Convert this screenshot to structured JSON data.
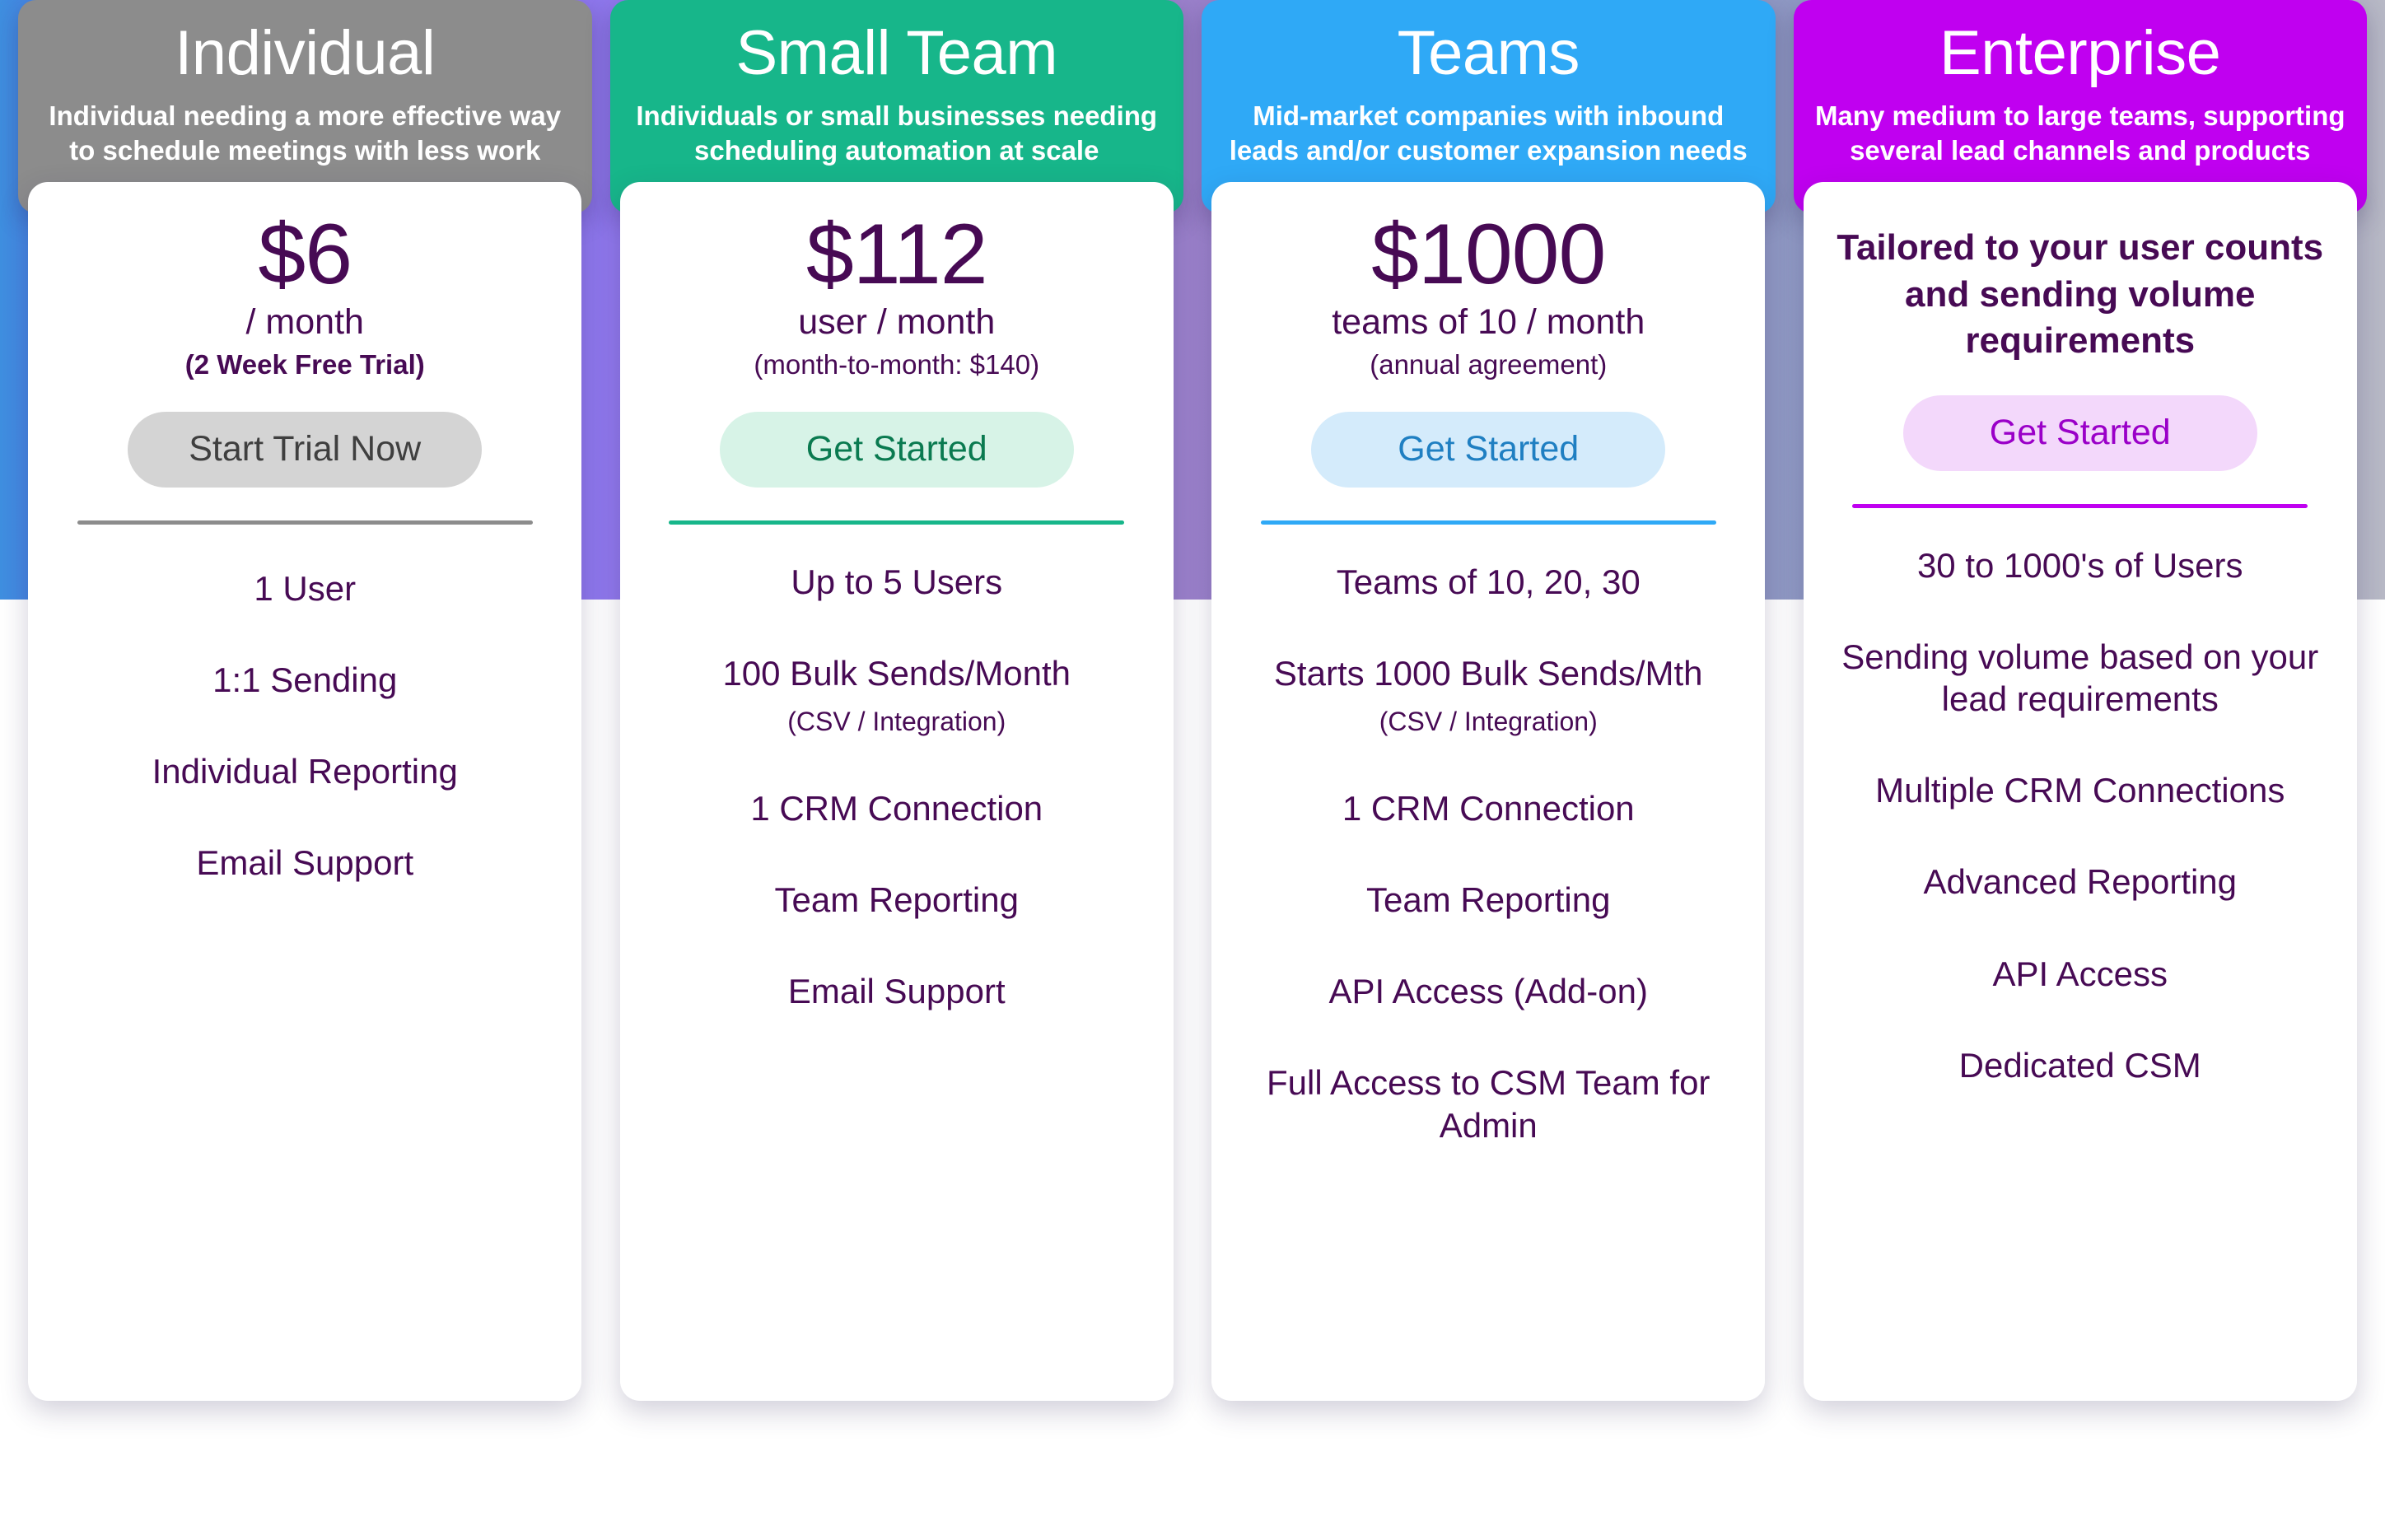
{
  "plans": [
    {
      "id": "individual",
      "title": "Individual",
      "subtitle": "Individual needing a more effective way to schedule meetings with less work",
      "header_color": "#8c8c8c",
      "price": "$6",
      "price_unit": "/ month",
      "price_note": "(2 Week Free Trial)",
      "cta_label": "Start Trial Now",
      "cta_bg": "#d4d4d4",
      "cta_text_color": "#3f3f3f",
      "features": [
        {
          "label": "1 User",
          "sub": ""
        },
        {
          "label": "1:1 Sending",
          "sub": ""
        },
        {
          "label": "Individual Reporting",
          "sub": ""
        },
        {
          "label": "Email Support",
          "sub": ""
        }
      ]
    },
    {
      "id": "small-team",
      "title": "Small Team",
      "subtitle": "Individuals or small businesses needing scheduling automation at scale",
      "header_color": "#17b68a",
      "price": "$112",
      "price_unit": "user / month",
      "price_note": "(month-to-month: $140)",
      "cta_label": "Get Started",
      "cta_bg": "#d7f3e7",
      "cta_text_color": "#0a7a50",
      "features": [
        {
          "label": "Up to 5 Users",
          "sub": ""
        },
        {
          "label": "100 Bulk Sends/Month",
          "sub": "(CSV / Integration)"
        },
        {
          "label": "1 CRM Connection",
          "sub": ""
        },
        {
          "label": "Team Reporting",
          "sub": ""
        },
        {
          "label": "Email Support",
          "sub": ""
        }
      ]
    },
    {
      "id": "teams",
      "title": "Teams",
      "subtitle": "Mid-market companies with inbound leads and/or customer expansion needs",
      "header_color": "#2fa9f6",
      "price": "$1000",
      "price_unit": "teams of 10 / month",
      "price_note": "(annual agreement)",
      "cta_label": "Get Started",
      "cta_bg": "#d4ebfb",
      "cta_text_color": "#1f7fc2",
      "features": [
        {
          "label": "Teams of 10, 20, 30",
          "sub": ""
        },
        {
          "label": "Starts 1000 Bulk Sends/Mth",
          "sub": "(CSV / Integration)"
        },
        {
          "label": "1 CRM Connection",
          "sub": ""
        },
        {
          "label": "Team Reporting",
          "sub": ""
        },
        {
          "label": "API Access (Add-on)",
          "sub": ""
        },
        {
          "label": "Full Access to CSM Team for Admin",
          "sub": ""
        }
      ]
    },
    {
      "id": "enterprise",
      "title": "Enterprise",
      "subtitle": "Many medium to large teams, supporting several lead channels and products",
      "header_color": "#c000f0",
      "price": "",
      "price_unit": "",
      "price_note": "",
      "custom_price": "Tailored to your user counts and sending volume requirements",
      "cta_label": "Get Started",
      "cta_bg": "#f3d8fb",
      "cta_text_color": "#9a00c8",
      "features": [
        {
          "label": "30 to 1000's of Users",
          "sub": ""
        },
        {
          "label": "Sending volume based on your lead requirements",
          "sub": ""
        },
        {
          "label": "Multiple CRM Connections",
          "sub": ""
        },
        {
          "label": "Advanced Reporting",
          "sub": ""
        },
        {
          "label": "API Access",
          "sub": ""
        },
        {
          "label": "Dedicated CSM",
          "sub": ""
        }
      ]
    }
  ],
  "theme": {
    "price_text_color": "#470a54",
    "feature_text_color": "#470a54",
    "card_background": "#ffffff",
    "backdrop_gradient_start": "#3f8fe0",
    "backdrop_gradient_mid": "#8a76ef",
    "backdrop_gradient_end": "#b8b9c6"
  }
}
